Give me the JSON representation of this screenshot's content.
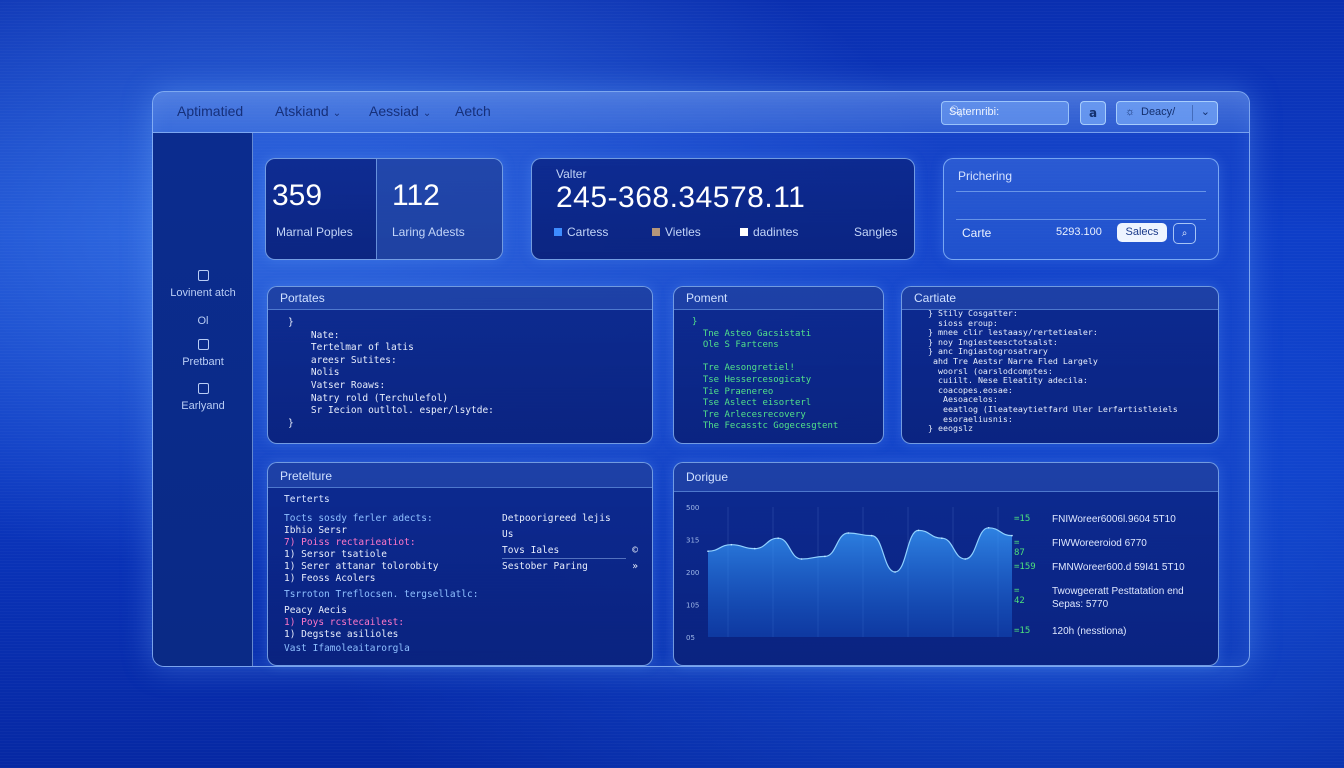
{
  "topbar": {
    "nav": [
      {
        "label": "Aptimatied",
        "dropdown": false
      },
      {
        "label": "Atskiand",
        "dropdown": true
      },
      {
        "label": "Aessiad",
        "dropdown": true
      },
      {
        "label": "Aetch",
        "dropdown": false
      }
    ],
    "search_value": "Saternribi:",
    "square_button": "a",
    "dropdown_label": "Deacy/",
    "dropdown_icon": "lightbulb-icon"
  },
  "sidebar": {
    "items": [
      {
        "label": "Lovinent atch",
        "icon": "export-icon"
      },
      {
        "label": "",
        "icon": "document-icon"
      },
      {
        "label": "Pretbant",
        "icon": "grid-icon"
      },
      {
        "label": "Earlyand",
        "icon": "save-icon"
      }
    ]
  },
  "stats": {
    "card1": {
      "value": "359",
      "label": "Marnal Poples"
    },
    "card2": {
      "value": "112",
      "label": "Laring Adests"
    }
  },
  "valter": {
    "title": "Valter",
    "value": "245-368.34578.11",
    "legend": [
      {
        "label": "Cartess",
        "color": "#3d8cff"
      },
      {
        "label": "Vietles",
        "color": "#b5967a"
      },
      {
        "label": "dadintes",
        "color": "#ffffff"
      }
    ],
    "right_label": "Sangles"
  },
  "prichering": {
    "title": "Prichering",
    "row_label": "Carte",
    "row_value": "5293.100",
    "button": "Salecs"
  },
  "portates": {
    "title": "Portates",
    "lines": [
      "}",
      "    Nate:",
      "    Tertelmar of latis",
      "    areesr Sutites:",
      "    Nolis",
      "    Vatser Roaws:",
      "    Natry rold (Terchulefol)",
      "    Sr Iecion outltol. esper/lsytde:",
      "}"
    ]
  },
  "poment": {
    "title": "Poment",
    "lines": [
      "}",
      "  Tne Asteo Gacsistati",
      "  Ole S Fartcens",
      "",
      "  Tre Aesongretiel!",
      "  Tse Hessercesogicaty",
      "  Tie Praenereo",
      "  Tse Aslect eisorterl",
      "  Tre Arlecesrecovery",
      "  The Fecasstc Gogecesgtent"
    ]
  },
  "cartiate": {
    "title": "Cartiate",
    "lines": [
      "  } Stily Cosgatter:",
      "    sioss eroup:",
      "  } mnee clir lestaasy/rertetiealer:",
      "  } noy Ingiesteesctotsalst:",
      "  } anc Ingiastogrosatrary",
      "   ahd Tre Aestsr Narre Fled Largely",
      "    woorsl (oarslodcomptes:",
      "    cuiilt. Nese Eleatity adecila:",
      "    coacopes.eosae:",
      "     Aesoacelos:",
      "     eeatlog (Ileateaytietfard Uler Lerfartistleiels",
      "     esoraeliusnis:",
      "  } eeogslz"
    ]
  },
  "pretelture": {
    "title": "Pretelture",
    "subtitle": "Terterts",
    "left_lines": [
      {
        "text": "Tocts sosdy ferler adects:",
        "color": "#8fc0ff"
      },
      {
        "text": "Ibhio Sersr",
        "color": "#e8eefc"
      },
      {
        "text": "7) Poiss rectarieatiot:",
        "color": "#ff77c8"
      },
      {
        "text": "1) Sersor tsatiole",
        "color": "#e8eefc"
      },
      {
        "text": "1) Serer attanar tolorobity",
        "color": "#e8eefc"
      },
      {
        "text": "1) Feoss Acolers",
        "color": "#e8eefc"
      },
      {
        "text": "Tsrroton Treflocsen. tergsellatlc:",
        "color": "#8fc0ff"
      },
      {
        "text": "Peacy Aecis",
        "color": "#e8eefc"
      },
      {
        "text": "1) Poys rcstecailest:",
        "color": "#ff77c8"
      },
      {
        "text": "1) Degstse asilioles",
        "color": "#e8eefc"
      },
      {
        "text": "Vast Ifamoleaitarorgla",
        "color": "#8fc0ff"
      }
    ],
    "right_items": [
      {
        "label": "Detpoorigreed lejis",
        "value": ""
      },
      {
        "label": "Us",
        "value": ""
      },
      {
        "label": "Tovs Iales",
        "value": "©"
      },
      {
        "label": "Sestober Paring",
        "value": "»"
      }
    ]
  },
  "dorigue": {
    "title": "Dorigue",
    "chart_data": {
      "type": "area",
      "title": "Dorigue",
      "y_ticks": [
        "500",
        "315",
        "200",
        "105",
        "05"
      ],
      "values": [
        330,
        355,
        340,
        380,
        300,
        310,
        400,
        390,
        250,
        410,
        380,
        300,
        420,
        390
      ]
    },
    "legend_items": [
      {
        "code": "=15",
        "label": "FNIWoreer6006l.9604 5T10"
      },
      {
        "code": "= 87",
        "label": "FIWWoreeroiod 6770"
      },
      {
        "code": "=159",
        "label": "FMNWoreer600.d 59I41 5T10"
      },
      {
        "code": "= 42",
        "label": "Twowgeeratt Pesttatation end\nSepas: 5770"
      },
      {
        "code": "=15",
        "label": "120h (nesstiona)"
      }
    ]
  }
}
